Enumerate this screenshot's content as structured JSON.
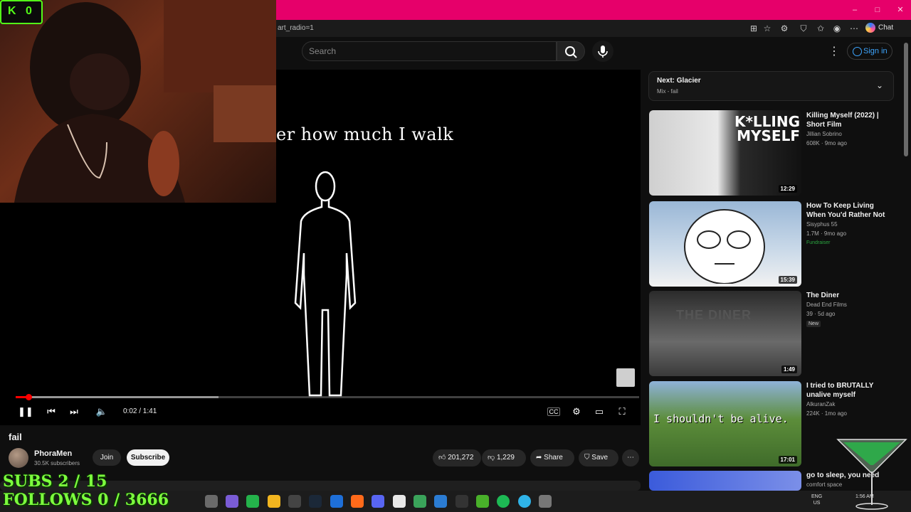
{
  "browser": {
    "url": "art_radio=1",
    "chat_label": "Chat"
  },
  "header": {
    "search_placeholder": "Search",
    "sign_in": "Sign in"
  },
  "player": {
    "caption": "er how much I walk",
    "time": "0:02 / 1:41",
    "progress_fraction": 0.02,
    "buffered_fraction": 0.325
  },
  "video": {
    "title": "fail",
    "channel": "PhoraMen",
    "subscribers": "30.5K subscribers",
    "join": "Join",
    "subscribe": "Subscribe",
    "likes": "201,272",
    "dislikes": "1,229",
    "share": "Share",
    "save": "Save"
  },
  "up_next": {
    "title": "Next: Glacier",
    "subtitle": "Mix - fail"
  },
  "recommendations": [
    {
      "title": "Killing Myself (2022) | Short Film",
      "channel": "Jillian Sobrino",
      "meta": "608K · 9mo ago",
      "duration": "12:29",
      "badge": "",
      "thumb_text": "K*LLING MYSELF"
    },
    {
      "title": "How To Keep Living When You'd Rather Not",
      "channel": "Sisyphus 55",
      "meta": "1.7M · 9mo ago",
      "duration": "15:39",
      "badge": "Fundraiser",
      "thumb_text": ""
    },
    {
      "title": "The Diner",
      "channel": "Dead End Films",
      "meta": "39 · 5d ago",
      "duration": "1:49",
      "badge": "New",
      "thumb_text": "THE DINER"
    },
    {
      "title": "I tried to BRUTALLY unalive myself",
      "channel": "AlkuranZak",
      "meta": "224K · 1mo ago",
      "duration": "17:01",
      "badge": "",
      "thumb_text": "I shouldn't be alive."
    },
    {
      "title": "go to sleep, you need",
      "channel": "comfort space",
      "meta": "",
      "duration": "",
      "badge": "",
      "thumb_text": ""
    }
  ],
  "stream": {
    "kick_letter": "K",
    "kick_count": "0",
    "subs_goal": "SUBS 2 / 15",
    "follows_goal": "FOLLOWS 0 / 3666"
  },
  "taskbar": {
    "lang_top": "ENG",
    "lang_bottom": "US",
    "time": "1:56 AM"
  },
  "colors": {
    "titlebar": "#e6006a",
    "accent_red": "#ff0000",
    "kick_green": "#53fc18"
  }
}
